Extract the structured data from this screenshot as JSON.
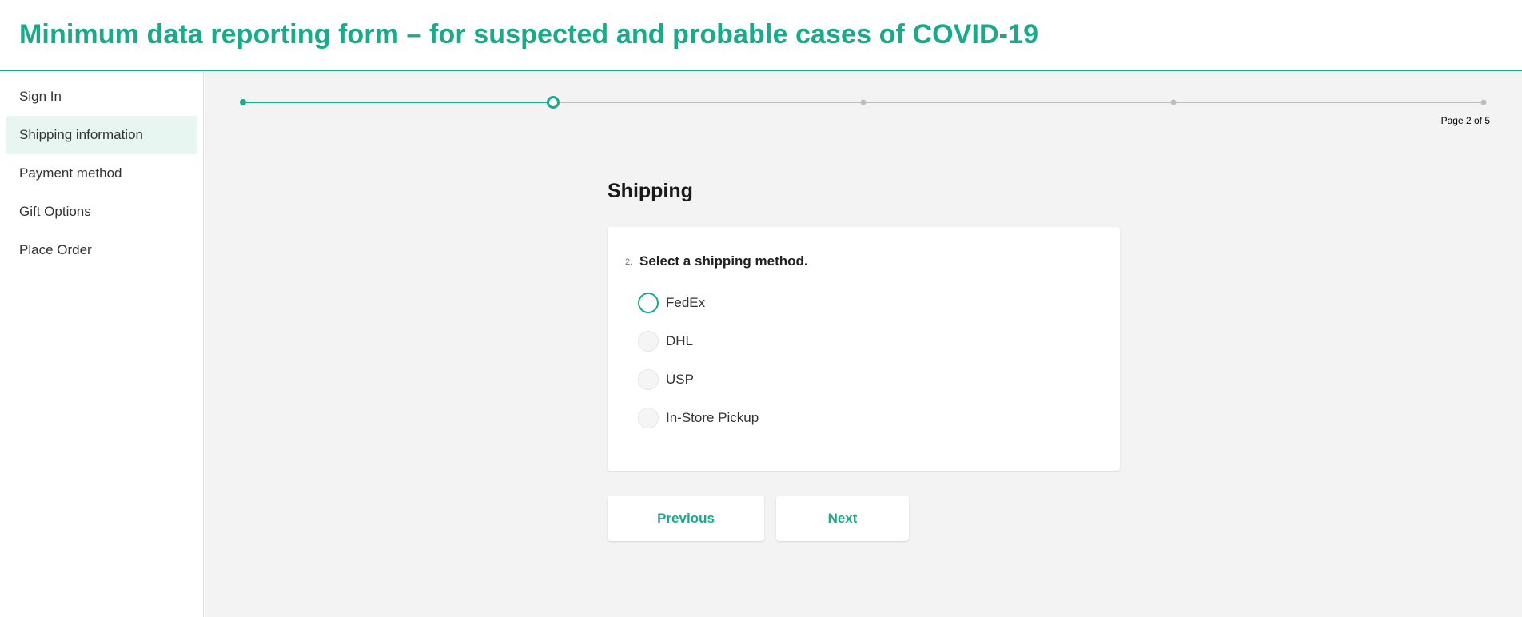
{
  "header": {
    "title": "Minimum data reporting form – for suspected and probable cases of COVID-19"
  },
  "sidebar": {
    "items": [
      {
        "label": "Sign In",
        "active": false
      },
      {
        "label": "Shipping information",
        "active": true
      },
      {
        "label": "Payment method",
        "active": false
      },
      {
        "label": "Gift Options",
        "active": false
      },
      {
        "label": "Place Order",
        "active": false
      }
    ]
  },
  "progress": {
    "current_page": 2,
    "total_pages": 5,
    "label": "Page 2 of 5"
  },
  "page": {
    "heading": "Shipping",
    "question": {
      "number": "2.",
      "text": "Select a shipping method.",
      "options": [
        "FedEx",
        "DHL",
        "USP",
        "In-Store Pickup"
      ],
      "focused_option": "FedEx"
    }
  },
  "buttons": {
    "previous_label": "Previous",
    "next_label": "Next"
  },
  "colors": {
    "accent": "#1aaa8a",
    "background": "#f3f3f3",
    "inactive_step": "#bdbdbd"
  }
}
